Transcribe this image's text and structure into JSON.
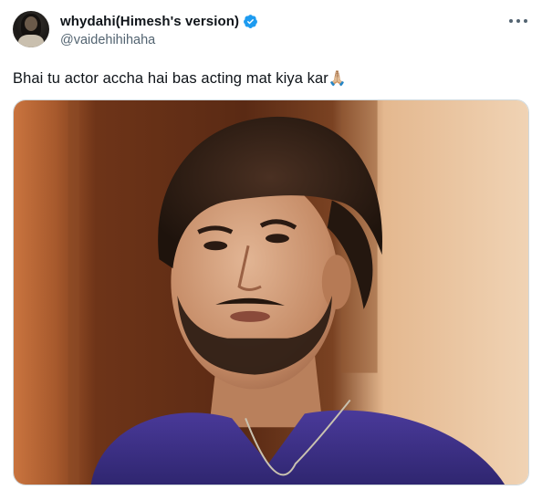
{
  "author": {
    "display_name": "whydahi(Himesh's version)",
    "handle": "@vaidehihihaha",
    "avatar_icon": "user-avatar",
    "verified_icon": "verified-badge-icon",
    "verified_color": "#1d9bf0"
  },
  "menu": {
    "icon": "more-options-icon"
  },
  "tweet": {
    "text": "Bhai tu actor accha hai bas acting mat kiya kar",
    "emoji": "🙏🏼"
  },
  "media": {
    "icon": "photo"
  },
  "colors": {
    "text_primary": "#0f1419",
    "text_secondary": "#536471",
    "border": "#cfd9de"
  }
}
